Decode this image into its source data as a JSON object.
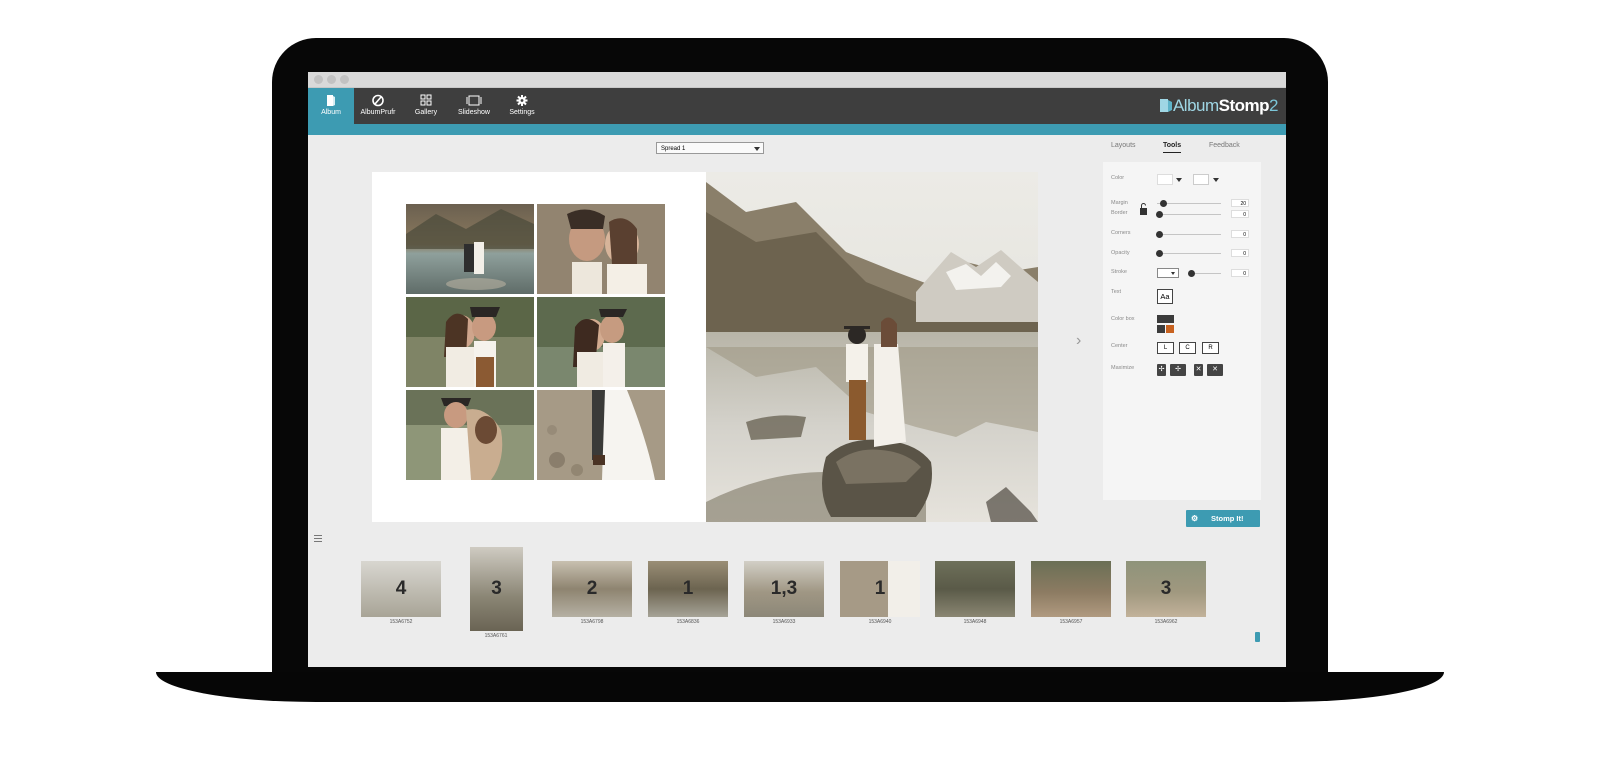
{
  "toolbar": {
    "items": [
      {
        "label": "Album",
        "icon": "album-icon",
        "active": true
      },
      {
        "label": "AlbumPrufr",
        "icon": "prufr-icon",
        "active": false
      },
      {
        "label": "Gallery",
        "icon": "grid-icon",
        "active": false
      },
      {
        "label": "Slideshow",
        "icon": "slideshow-icon",
        "active": false
      },
      {
        "label": "Settings",
        "icon": "gear-icon",
        "active": false
      }
    ],
    "logo": {
      "album": "Album",
      "stomp": "Stomp",
      "num": "2"
    }
  },
  "spread": {
    "selected": "Spread 1"
  },
  "tabs": [
    {
      "label": "Layouts",
      "active": false
    },
    {
      "label": "Tools",
      "active": true
    },
    {
      "label": "Feedback",
      "active": false
    }
  ],
  "tools": {
    "color_label": "Color",
    "margin_label": "Margin",
    "margin_value": "20",
    "border_label": "Border",
    "border_value": "0",
    "corners_label": "Corners",
    "corners_value": "0",
    "opacity_label": "Opacity",
    "opacity_value": "0",
    "stroke_label": "Stroke",
    "stroke_value": "0",
    "text_label": "Text",
    "text_button": "Aa",
    "colorbox_label": "Color box",
    "center_label": "Center",
    "center_buttons": [
      "L",
      "C",
      "R"
    ],
    "maximize_label": "Maximize"
  },
  "stomp_button": "Stomp It!",
  "filmstrip": [
    {
      "count": "4",
      "name": "153A6752"
    },
    {
      "count": "3",
      "name": "153A6761"
    },
    {
      "count": "2",
      "name": "153A6798"
    },
    {
      "count": "1",
      "name": "153A6836"
    },
    {
      "count": "1,3",
      "name": "153A6933"
    },
    {
      "count": "1",
      "name": "153A6940"
    },
    {
      "count": "",
      "name": "153A6948"
    },
    {
      "count": "",
      "name": "153A6957"
    },
    {
      "count": "3",
      "name": "153A6962"
    }
  ],
  "colors": {
    "accent": "#3d9bb2",
    "toolbar": "#3e3e3e",
    "colorbox_orange": "#c8621f"
  }
}
